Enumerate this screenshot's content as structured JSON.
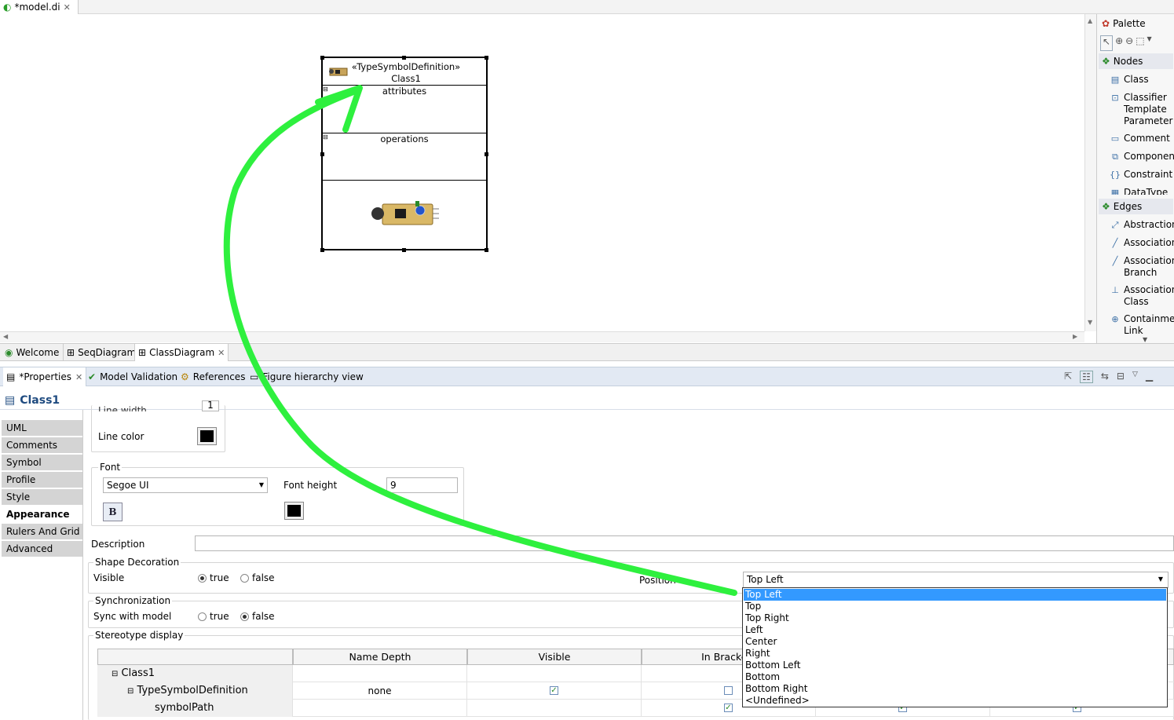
{
  "editor": {
    "tab_label": "*model.di"
  },
  "class_node": {
    "stereotype": "«TypeSymbolDefinition»",
    "name": "Class1",
    "attributes_label": "attributes",
    "operations_label": "operations"
  },
  "palette": {
    "title": "Palette",
    "nodes_group": "Nodes",
    "nodes": [
      "Class",
      "Classifier Template Parameter",
      "Comment",
      "Component",
      "Constraint",
      "DataType"
    ],
    "edges_group": "Edges",
    "edges": [
      "Abstraction",
      "Association",
      "Association Branch",
      "Association Class",
      "Containment Link"
    ]
  },
  "diagram_tabs": [
    "Welcome",
    "SeqDiagram",
    "ClassDiagram"
  ],
  "views": [
    "*Properties",
    "Model Validation",
    "References",
    "Figure hierarchy view"
  ],
  "properties": {
    "title": "Class1",
    "tabs": [
      "UML",
      "Comments",
      "Symbol",
      "Profile",
      "Style",
      "Appearance",
      "Rulers And Grid",
      "Advanced"
    ],
    "selected_tab": "Appearance",
    "line_width_label": "Line width",
    "line_width_value": "1",
    "line_color_label": "Line color",
    "font_group": "Font",
    "font_name": "Segoe UI",
    "font_height_label": "Font height",
    "font_height_value": "9",
    "bold_label": "B",
    "description_label": "Description",
    "shape_decoration": {
      "group": "Shape Decoration",
      "visible_label": "Visible",
      "true_label": "true",
      "false_label": "false",
      "visible_value": "true",
      "position_label": "Position",
      "position_value": "Top Left",
      "options": [
        "Top Left",
        "Top",
        "Top Right",
        "Left",
        "Center",
        "Right",
        "Bottom Left",
        "Bottom",
        "Bottom Right",
        "<Undefined>"
      ]
    },
    "synchronization": {
      "group": "Synchronization",
      "sync_label": "Sync with model",
      "true_label": "true",
      "false_label": "false",
      "value": "false"
    },
    "stereotype_display": {
      "group": "Stereotype display",
      "columns": [
        "",
        "Name Depth",
        "Visible",
        "In Brackets"
      ],
      "rows": [
        {
          "name": "Class1",
          "depth": "",
          "visible": null,
          "brackets": null
        },
        {
          "name": "TypeSymbolDefinition",
          "depth": "none",
          "visible": true,
          "brackets": false
        },
        {
          "name": "symbolPath",
          "depth": "",
          "visible": null,
          "brackets": true
        }
      ]
    }
  },
  "colors": {
    "arrow": "#2ef03e",
    "selection": "#3399ff",
    "views_bar": "#e2e9f3"
  }
}
